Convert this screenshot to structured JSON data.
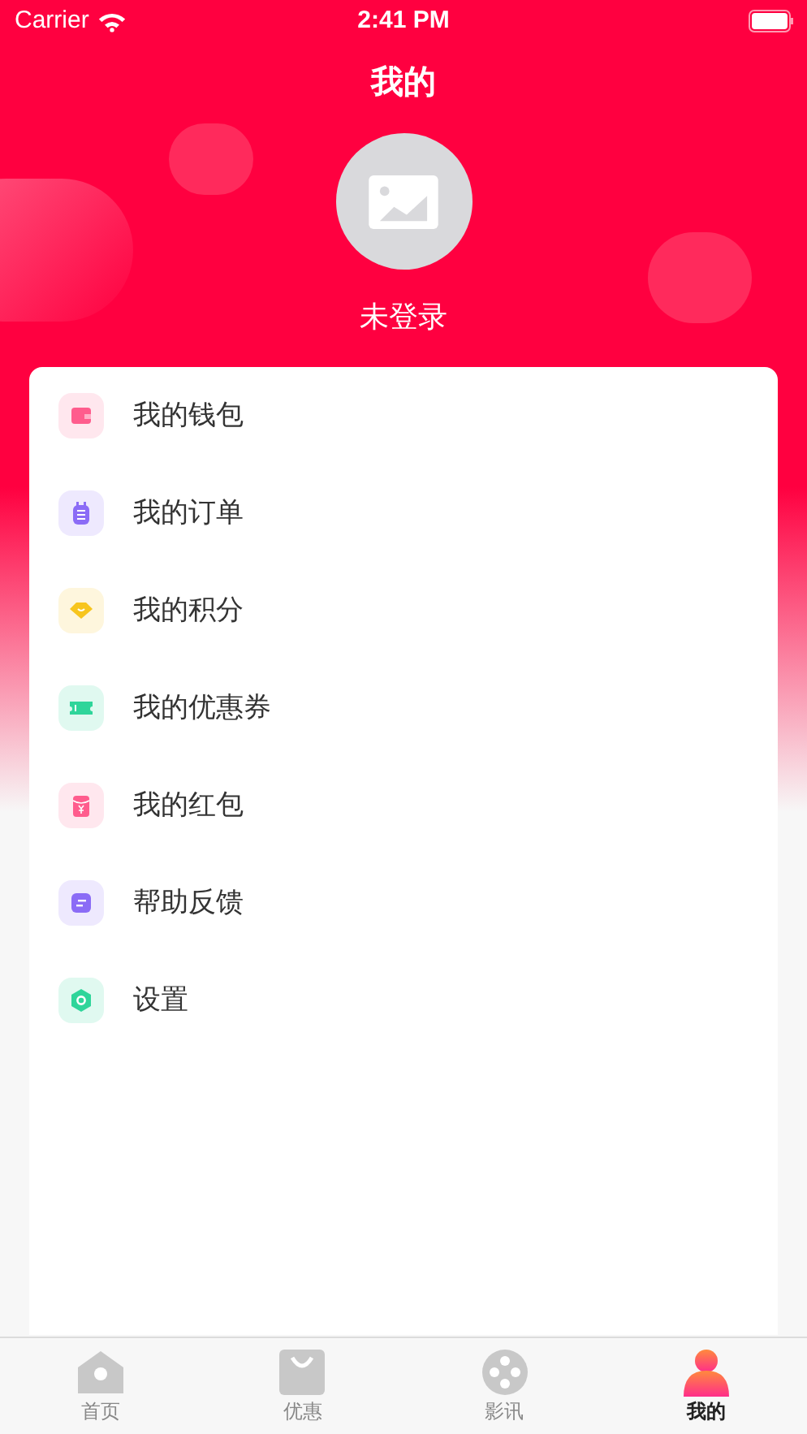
{
  "status_bar": {
    "carrier": "Carrier",
    "time": "2:41 PM"
  },
  "header": {
    "title": "我的",
    "username": "未登录"
  },
  "menu": [
    {
      "kind": "wallet",
      "label": "我的钱包",
      "color": "#ff5c8d"
    },
    {
      "kind": "order",
      "label": "我的订单",
      "color": "#8b6cf6"
    },
    {
      "kind": "points",
      "label": "我的积分",
      "color": "#f7c51e"
    },
    {
      "kind": "coupon",
      "label": "我的优惠券",
      "color": "#2fd59a"
    },
    {
      "kind": "redpacket",
      "label": "我的红包",
      "color": "#ff5c8d"
    },
    {
      "kind": "feedback",
      "label": "帮助反馈",
      "color": "#8b6cf6"
    },
    {
      "kind": "settings",
      "label": "设置",
      "color": "#2fd59a"
    }
  ],
  "tabs": [
    {
      "kind": "home",
      "label": "首页",
      "selected": false
    },
    {
      "kind": "deals",
      "label": "优惠",
      "selected": false
    },
    {
      "kind": "film",
      "label": "影讯",
      "selected": false
    },
    {
      "kind": "profile",
      "label": "我的",
      "selected": true
    }
  ]
}
